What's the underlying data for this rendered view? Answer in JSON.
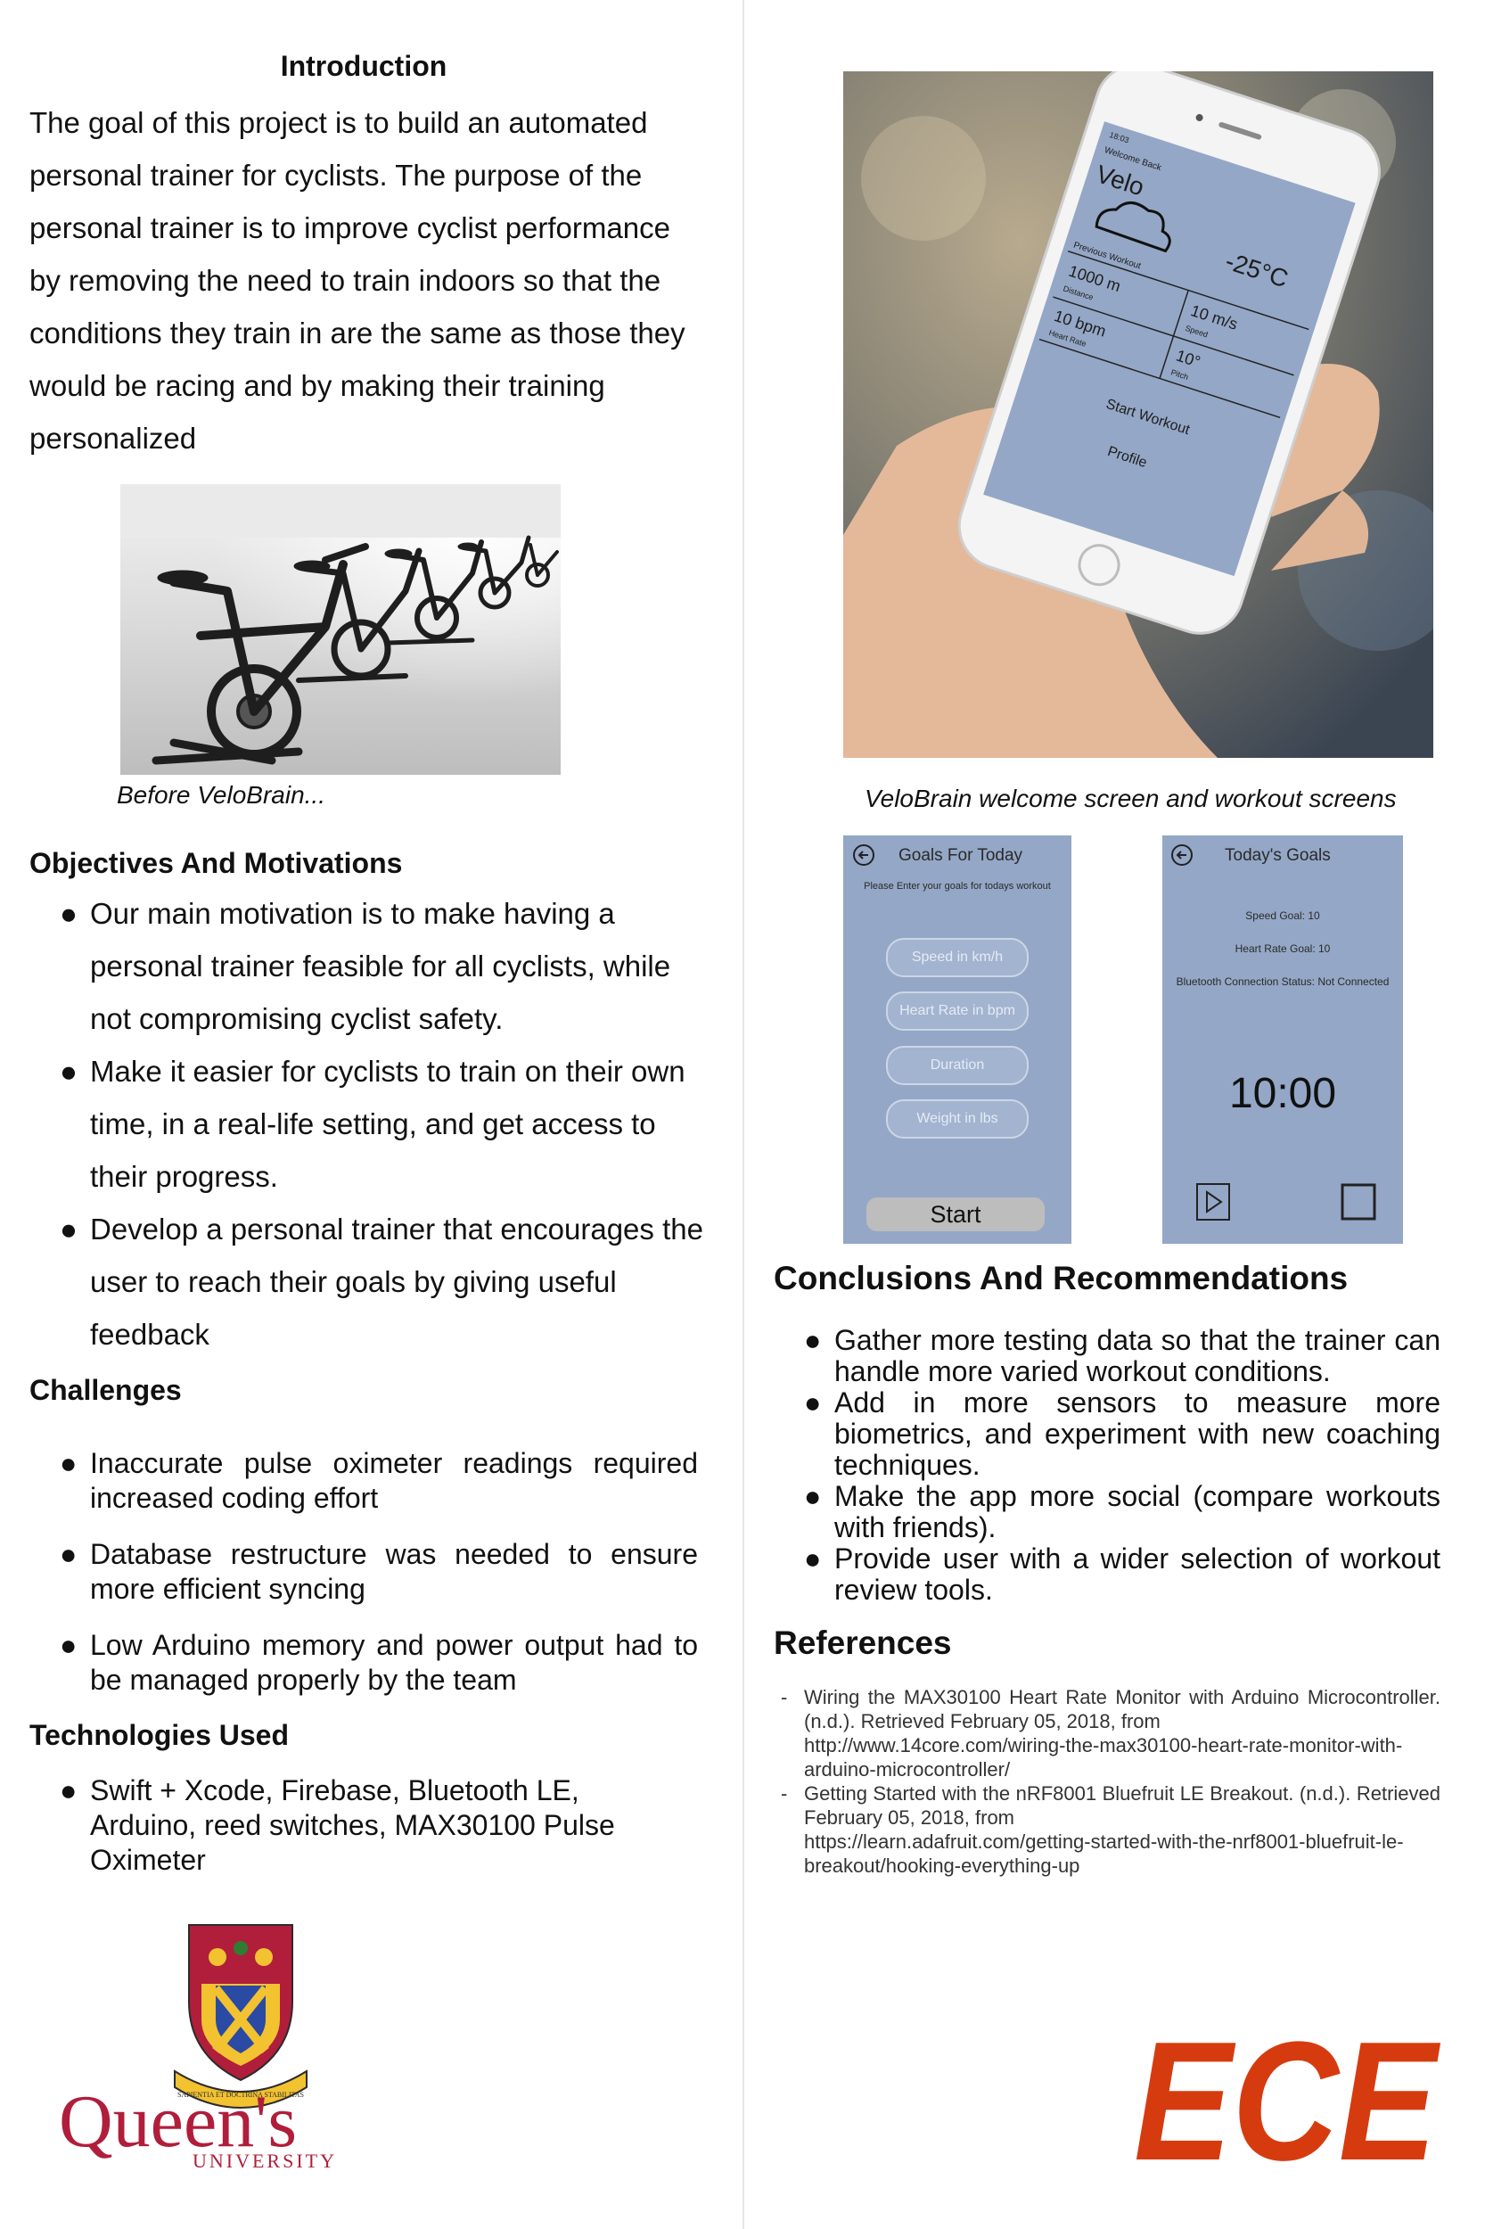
{
  "intro": {
    "title": "Introduction",
    "text": "The goal of this project is to build an automated personal trainer for cyclists. The purpose of the personal trainer is to improve cyclist performance by removing the need to train indoors so that the conditions they train in are the same as those they would be racing and by making their training personalized"
  },
  "left_caption": "Before VeloBrain...",
  "objectives": {
    "title": "Objectives And Motivations",
    "items": [
      "Our main motivation is to make having a personal trainer feasible for all cyclists, while not compromising cyclist safety.",
      "Make it easier for cyclists to train on their own time, in a real-life setting, and get access to their progress.",
      "Develop a personal trainer that encourages the user to reach their goals by giving useful feedback"
    ]
  },
  "challenges": {
    "title": "Challenges",
    "items": [
      "Inaccurate pulse oximeter readings required increased coding effort",
      "Database restructure was needed to ensure more efficient syncing",
      "Low Arduino memory and power output had to be managed properly by the team"
    ]
  },
  "technologies": {
    "title": "Technologies Used",
    "items": [
      "Swift + Xcode, Firebase, Bluetooth LE, Arduino, reed switches, MAX30100 Pulse Oximeter"
    ]
  },
  "logo_text": {
    "queens_name": "Queen's",
    "queens_sub": "UNIVERSITY",
    "motto": "SAPIENTIA ET DOCTRINA STABILITAS",
    "ece": "ECE"
  },
  "phone_screen": {
    "time": "18:03",
    "welcome": "Welcome Back",
    "app": "Velo",
    "temp": "-25°C",
    "previous": "Previous Workout",
    "distance": "1000 m",
    "distance_label": "Distance",
    "speed": "10 m/s",
    "speed_label": "Speed",
    "hr": "10 bpm",
    "hr_label": "Heart Rate",
    "pitch": "10°",
    "pitch_label": "Pitch",
    "start": "Start Workout",
    "profile": "Profile"
  },
  "right_caption": "VeloBrain welcome screen and workout screens",
  "goals_screen": {
    "title": "Goals For Today",
    "subtitle": "Please Enter your goals for todays workout",
    "fields": [
      "Speed in km/h",
      "Heart Rate in bpm",
      "Duration",
      "Weight in lbs"
    ],
    "start": "Start"
  },
  "today_screen": {
    "title": "Today's Goals",
    "speed_goal": "Speed Goal: 10",
    "hr_goal": "Heart Rate Goal: 10",
    "bt_status": "Bluetooth Connection Status: Not Connected",
    "timer": "10:00"
  },
  "conclusions": {
    "title": "Conclusions And Recommendations",
    "items": [
      "Gather more testing data so that the trainer can handle more varied workout conditions.",
      "Add in more sensors to measure more biometrics, and experiment with new coaching techniques.",
      "Make the app more social (compare workouts with friends).",
      "Provide user with a wider selection of workout review tools."
    ]
  },
  "references": {
    "title": "References",
    "items": [
      {
        "text": "Wiring the MAX30100 Heart Rate Monitor with Arduino Microcontroller. (n.d.). Retrieved February 05, 2018, from",
        "url": "http://www.14core.com/wiring-the-max30100-heart-rate-monitor-with-arduino-microcontroller/"
      },
      {
        "text": "Getting Started with the nRF8001 Bluefruit LE Breakout. (n.d.). Retrieved February 05, 2018, from",
        "url": "https://learn.adafruit.com/getting-started-with-the-nrf8001-bluefruit-le-breakout/hooking-everything-up"
      }
    ]
  },
  "colors": {
    "queens_red": "#b01e3b",
    "ece_red": "#d63b10",
    "app_blue": "#94a7c6"
  }
}
